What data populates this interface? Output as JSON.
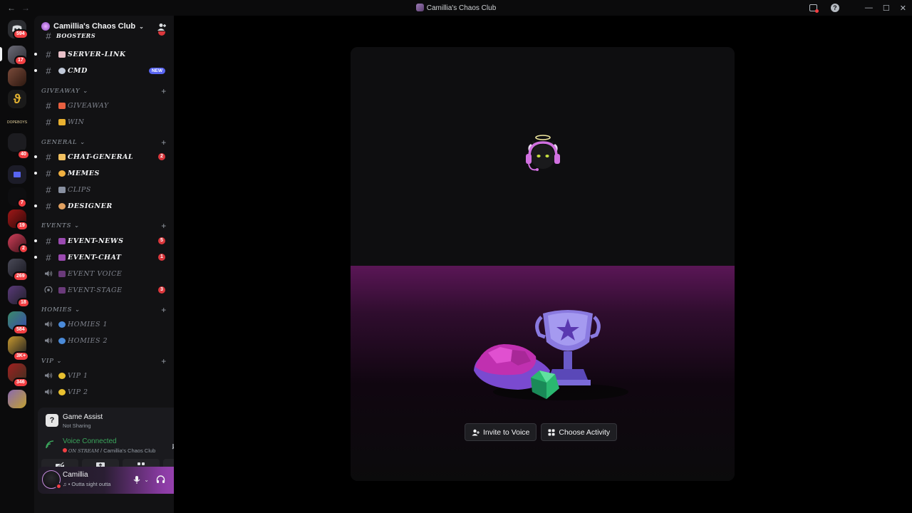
{
  "window": {
    "title": "Camillia's Chaos Club"
  },
  "rail": {
    "badges": [
      "594",
      "17",
      "40",
      "7",
      "19",
      "2",
      "269",
      "18",
      "584",
      "3K+",
      "346"
    ],
    "items": [
      "DOPEBOYS"
    ]
  },
  "server": {
    "name": "Camillia's Chaos Club"
  },
  "channels": {
    "partial_top": "BOOSTERS",
    "server_link": "SERVER-LINK",
    "cmd": "CMD",
    "new_badge": "NEW",
    "cat_giveaway": "GIVEAWAY",
    "giveaway": "GIVEAWAY",
    "win": "WIN",
    "cat_general": "GENERAL",
    "chat_general": "CHAT-GENERAL",
    "chat_general_count": "2",
    "memes": "MEMES",
    "clips": "CLIPS",
    "designer": "DESIGNER",
    "cat_events": "EVENTS",
    "event_news": "EVENT-NEWS",
    "event_news_count": "5",
    "event_chat": "EVENT-CHAT",
    "event_chat_count": "1",
    "event_voice": "EVENT VOICE",
    "event_stage": "EVENT-STAGE",
    "event_stage_count": "3",
    "cat_homies": "HOMIES",
    "homies1": "HOMIES 1",
    "homies2": "HOMIES 2",
    "cat_vip": "VIP",
    "vip1": "VIP 1",
    "vip2": "VIP 2"
  },
  "game_assist": {
    "title": "Game Assist",
    "subtitle": "Not Sharing"
  },
  "voice": {
    "title": "Voice Connected",
    "stream": "ON STREAM",
    "server": " / Camillia's Chaos Club"
  },
  "user": {
    "name": "Camillia",
    "status": "♫ • Outta sight outta"
  },
  "main": {
    "invite_label": "Invite to Voice",
    "activity_label": "Choose Activity"
  },
  "colors": {
    "accent": "#5865f2",
    "danger": "#da373c",
    "voice_green": "#3ba55c"
  }
}
